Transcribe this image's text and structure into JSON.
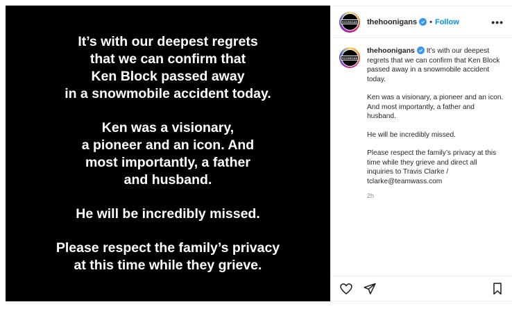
{
  "post_image": {
    "paragraphs": [
      "It’s with our deepest regrets\nthat we can confirm that\nKen Block passed away\nin a snowmobile accident today.",
      "Ken was a visionary,\na pioneer and an icon. And\nmost importantly, a father\nand husband.",
      "He will be incredibly missed.",
      "Please respect the family’s privacy\nat this time while they grieve."
    ]
  },
  "header": {
    "username": "thehoonigans",
    "separator": "•",
    "follow_label": "Follow",
    "more_label": "•••",
    "avatar_text": "HOONIGAN"
  },
  "caption": {
    "username": "thehoonigans",
    "first_text": "It’s with our deepest regrets that we can confirm that Ken Block passed away in a snowmobile accident today.",
    "paragraphs": [
      "Ken was a visionary, a pioneer and an icon. And most importantly, a father and husband.",
      "He will be incredibly missed.",
      "Please respect the family’s privacy at this time while they grieve and direct all inquiries to Travis Clarke / tclarke@teamwass.com"
    ],
    "timestamp": "2h"
  },
  "icons": {
    "verified": "verified-badge-icon",
    "like": "heart-icon",
    "share": "paper-plane-icon",
    "save": "bookmark-icon"
  },
  "colors": {
    "follow": "#0095f6",
    "verified": "#3897f0",
    "image_bg": "#000000"
  }
}
